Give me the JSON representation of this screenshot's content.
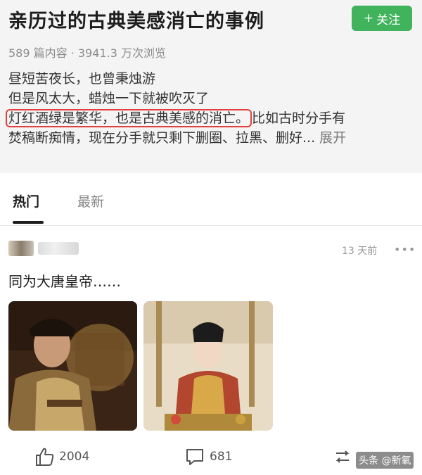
{
  "header": {
    "title": "亲历过的古典美感消亡的事例",
    "follow_label": "关注",
    "stats": "589 篇内容 · 3941.3 万次浏览"
  },
  "description": {
    "line1": "昼短苦夜长，也曾秉烛游",
    "line2": "但是风太大，蜡烛一下就被吹灭了",
    "line3_highlight": "灯红酒绿是繁华，也是古典美感的消亡。",
    "line3_rest": "比如古时分手有",
    "line4": "焚稿断痴情，现在分手就只剩下删圈、拉黑、删好...",
    "expand_label": "展开"
  },
  "tabs": [
    {
      "label": "热门"
    },
    {
      "label": "最新"
    }
  ],
  "post": {
    "time": "13 天前",
    "more_label": "•••",
    "text": "同为大唐皇帝……"
  },
  "actions": {
    "like_count": "2004",
    "comment_count": "681"
  },
  "watermark": "头条 @新氧",
  "colors": {
    "accent_green": "#41b35d",
    "highlight_red": "#e2403f"
  }
}
